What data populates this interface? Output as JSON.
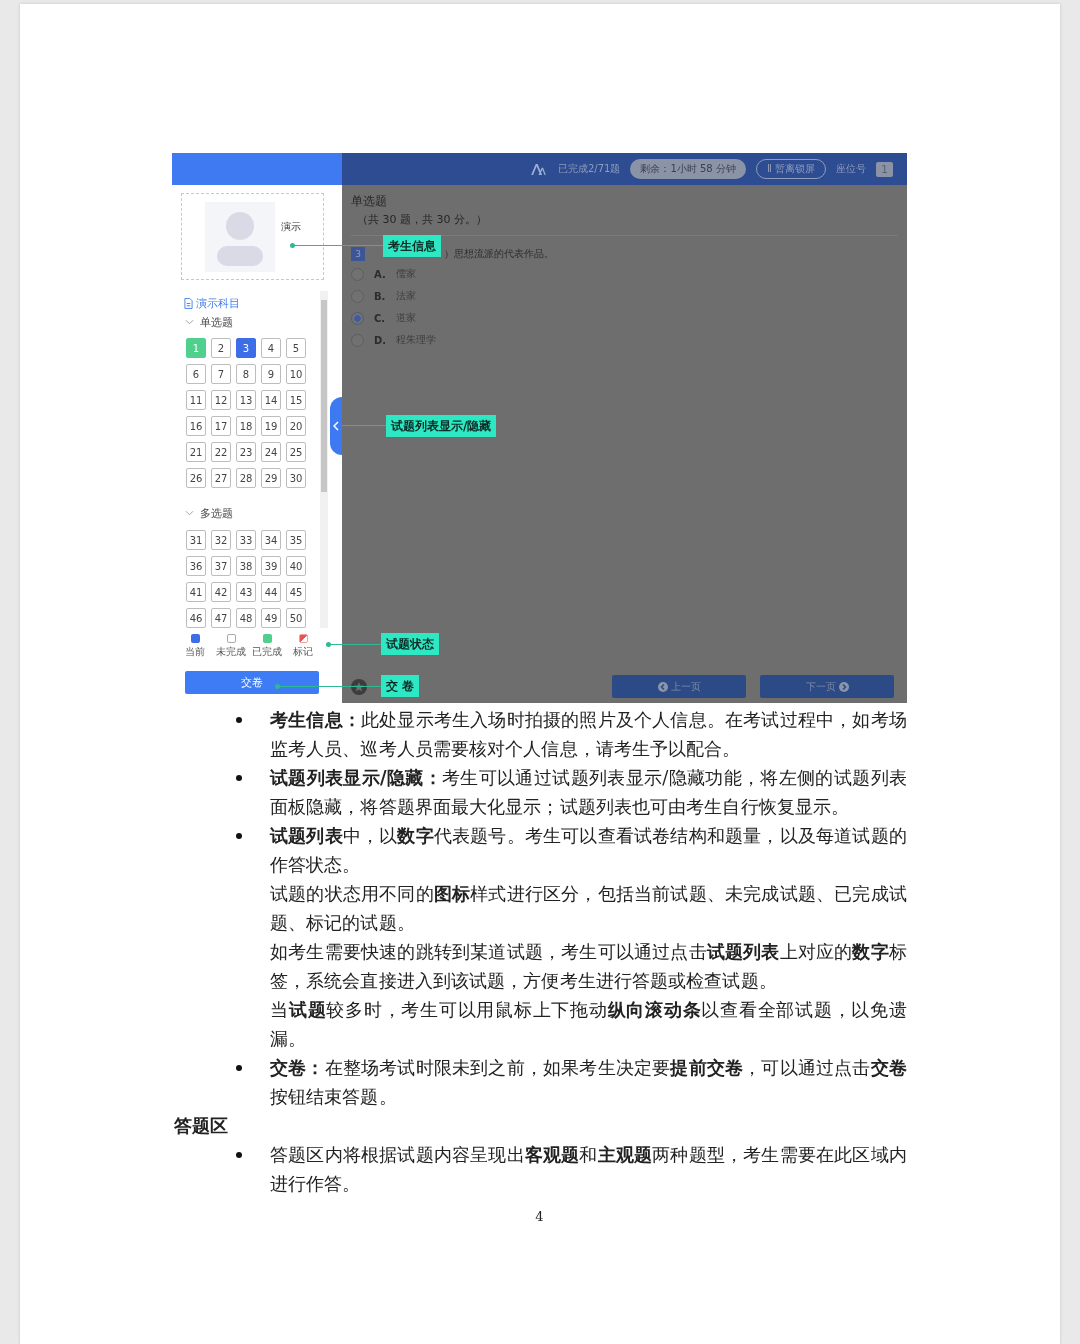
{
  "exam_screenshot": {
    "header": {
      "completed": "已完成2/71题",
      "remaining": "剩余：1小时 58 分钟",
      "lock_button": "Ⅱ 暂离锁屏",
      "seat_label": "座位号",
      "seat_number": "1"
    },
    "candidate": {
      "name": "演示"
    },
    "subject": "演示科目",
    "sections": [
      {
        "title": "单选题",
        "expanded": true,
        "questions": [
          {
            "number": "1",
            "kind": "done"
          },
          {
            "number": "2",
            "kind": "undone"
          },
          {
            "number": "3",
            "kind": "current"
          },
          {
            "number": "4",
            "kind": "undone"
          },
          {
            "number": "5",
            "kind": "undone"
          },
          {
            "number": "6",
            "kind": "undone"
          },
          {
            "number": "7",
            "kind": "undone"
          },
          {
            "number": "8",
            "kind": "undone"
          },
          {
            "number": "9",
            "kind": "undone"
          },
          {
            "number": "10",
            "kind": "undone"
          },
          {
            "number": "11",
            "kind": "undone"
          },
          {
            "number": "12",
            "kind": "undone"
          },
          {
            "number": "13",
            "kind": "undone"
          },
          {
            "number": "14",
            "kind": "undone"
          },
          {
            "number": "15",
            "kind": "undone"
          },
          {
            "number": "16",
            "kind": "undone"
          },
          {
            "number": "17",
            "kind": "undone"
          },
          {
            "number": "18",
            "kind": "undone"
          },
          {
            "number": "19",
            "kind": "undone"
          },
          {
            "number": "20",
            "kind": "undone"
          },
          {
            "number": "21",
            "kind": "undone"
          },
          {
            "number": "22",
            "kind": "undone"
          },
          {
            "number": "23",
            "kind": "undone"
          },
          {
            "number": "24",
            "kind": "undone"
          },
          {
            "number": "25",
            "kind": "undone"
          },
          {
            "number": "26",
            "kind": "undone"
          },
          {
            "number": "27",
            "kind": "undone"
          },
          {
            "number": "28",
            "kind": "undone"
          },
          {
            "number": "29",
            "kind": "undone"
          },
          {
            "number": "30",
            "kind": "undone"
          }
        ]
      },
      {
        "title": "多选题",
        "expanded": true,
        "questions": [
          {
            "number": "31",
            "kind": "undone"
          },
          {
            "number": "32",
            "kind": "undone"
          },
          {
            "number": "33",
            "kind": "undone"
          },
          {
            "number": "34",
            "kind": "undone"
          },
          {
            "number": "35",
            "kind": "undone"
          },
          {
            "number": "36",
            "kind": "undone"
          },
          {
            "number": "37",
            "kind": "undone"
          },
          {
            "number": "38",
            "kind": "undone"
          },
          {
            "number": "39",
            "kind": "undone"
          },
          {
            "number": "40",
            "kind": "undone"
          },
          {
            "number": "41",
            "kind": "undone"
          },
          {
            "number": "42",
            "kind": "undone"
          },
          {
            "number": "43",
            "kind": "undone"
          },
          {
            "number": "44",
            "kind": "undone"
          },
          {
            "number": "45",
            "kind": "undone"
          },
          {
            "number": "46",
            "kind": "undone"
          },
          {
            "number": "47",
            "kind": "undone"
          },
          {
            "number": "48",
            "kind": "undone"
          },
          {
            "number": "49",
            "kind": "undone"
          },
          {
            "number": "50",
            "kind": "undone"
          }
        ]
      }
    ],
    "legend": [
      {
        "label": "当前",
        "kind": "current"
      },
      {
        "label": "未完成",
        "kind": "undone"
      },
      {
        "label": "已完成",
        "kind": "done"
      },
      {
        "label": "标记",
        "kind": "marked"
      }
    ],
    "submit_button": "交卷",
    "question_panel": {
      "section_title": "单选题",
      "summary": "（共 30 题，共 30 分。）",
      "number": "3",
      "stem": "）思想流派的代表作品。",
      "options": [
        {
          "letter": "A.",
          "text": "儒家",
          "selected": false
        },
        {
          "letter": "B.",
          "text": "法家",
          "selected": false
        },
        {
          "letter": "C.",
          "text": "道家",
          "selected": true
        },
        {
          "letter": "D.",
          "text": "程朱理学",
          "selected": false
        }
      ]
    },
    "prev_button": "上一页",
    "next_button": "下一页",
    "callouts": [
      "考生信息",
      "试题列表显示/隐藏",
      "试题状态",
      "交 卷"
    ]
  },
  "bullets": [
    {
      "paragraphs": [
        "**考生信息：**此处显示考生入场时拍摄的照片及个人信息。在考试过程中，如考场监考人员、巡考人员需要核对个人信息，请考生予以配合。"
      ]
    },
    {
      "paragraphs": [
        "**试题列表显示/隐藏：**考生可以通过试题列表显示/隐藏功能，将左侧的试题列表面板隐藏，将答题界面最大化显示；试题列表也可由考生自行恢复显示。"
      ]
    },
    {
      "paragraphs": [
        "**试题列表**中，以**数字**代表题号。考生可以查看试卷结构和题量，以及每道试题的作答状态。",
        "试题的状态用不同的**图标**样式进行区分，包括当前试题、未完成试题、已完成试题、标记的试题。",
        "如考生需要快速的跳转到某道试题，考生可以通过点击**试题列表**上对应的**数字**标签，系统会直接进入到该试题，方便考生进行答题或检查试题。",
        "当**试题**较多时，考生可以用鼠标上下拖动**纵向滚动条**以查看全部试题，以免遗漏。"
      ]
    },
    {
      "paragraphs": [
        "**交卷：**在整场考试时限未到之前，如果考生决定要**提前交卷**，可以通过点击**交卷**按钮结束答题。"
      ]
    }
  ],
  "section_heading": "答题区",
  "section_bullets": [
    {
      "paragraphs": [
        "答题区内将根据试题内容呈现出**客观题**和**主观题**两种题型，考生需要在此区域内进行作答。"
      ]
    }
  ],
  "page_number": "4"
}
